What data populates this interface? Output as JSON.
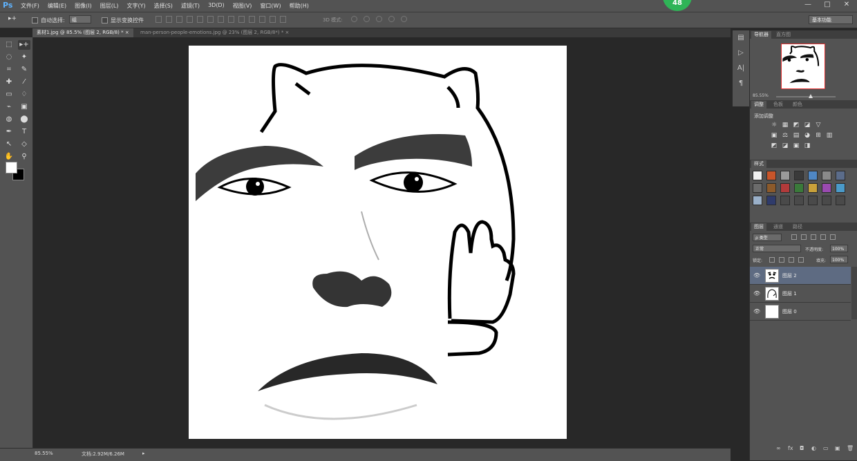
{
  "app": {
    "logo": "Ps",
    "menu": [
      "文件(F)",
      "编辑(E)",
      "图像(I)",
      "图层(L)",
      "文字(Y)",
      "选择(S)",
      "滤镜(T)",
      "3D(D)",
      "视图(V)",
      "窗口(W)",
      "帮助(H)"
    ],
    "badge": "48",
    "window_controls": [
      "—",
      "□",
      "✕"
    ]
  },
  "options": {
    "tool_glyph": "▸+",
    "auto_select_label": "自动选择:",
    "auto_select_value": "组",
    "show_transform_label": "显示变换控件",
    "mode_3d_label": "3D 模式:",
    "workspace": "基本功能"
  },
  "tabs": [
    {
      "label": "素材1.jpg @ 85.5% (图层 2, RGB/8) * ×"
    },
    {
      "label": "man-person-people-emotions.jpg @ 23% (图层 2, RGB/8*) * ×"
    }
  ],
  "tools": [
    "⬚",
    "▸+",
    "◌",
    "✦",
    "⌗",
    "✎",
    "✚",
    "⁄",
    "▭",
    "♢",
    "⌁",
    "▣",
    "◍",
    "⬤",
    "✒",
    "T",
    "↖",
    "◇",
    "✋",
    "⚲"
  ],
  "status": {
    "zoom": "85.55%",
    "doc": "文档:2.92M/6.26M",
    "arrow": "▸"
  },
  "navigator": {
    "tabs": [
      "导航器",
      "直方图"
    ],
    "zoom": "85.55%"
  },
  "adjustments": {
    "tabs": [
      "调整",
      "色板",
      "颜色"
    ],
    "title": "添加调整",
    "icons": [
      "☼",
      "▦",
      "◩",
      "◪",
      "▽",
      "▣",
      "⚖",
      "▤",
      "◕",
      "⊞",
      "▥",
      "◩",
      "◪",
      "▣",
      "◨"
    ]
  },
  "styles": {
    "tab": "样式",
    "swatches": [
      "#f2f2f2",
      "#c8552a",
      "#9a9a9a",
      "#3a3a3a",
      "#4f87c4",
      "#8a8a8a",
      "#5b6c8a",
      "#6b6b6b",
      "#8c5a2b",
      "#b23a3a",
      "#3a7a3a",
      "#c9a13a",
      "#9a4ab0",
      "#4a9ac9",
      "#9ab0c9",
      "#2f3b6b",
      "#4a4a4a",
      "#4a4a4a",
      "#4a4a4a",
      "#4a4a4a",
      "#4a4a4a"
    ]
  },
  "layers": {
    "tabs": [
      "图层",
      "通道",
      "路径"
    ],
    "kind": "ρ 类型",
    "blend": "正常",
    "opacity_label": "不透明度:",
    "opacity": "100%",
    "lock_label": "锁定:",
    "fill_label": "填充:",
    "fill": "100%",
    "items": [
      {
        "name": "图层 2",
        "selected": true
      },
      {
        "name": "图层 1",
        "selected": false
      },
      {
        "name": "图层 0",
        "selected": false
      }
    ],
    "footer_icons": [
      "∞",
      "fx",
      "◘",
      "◐",
      "▭",
      "▣",
      "🗑"
    ]
  }
}
